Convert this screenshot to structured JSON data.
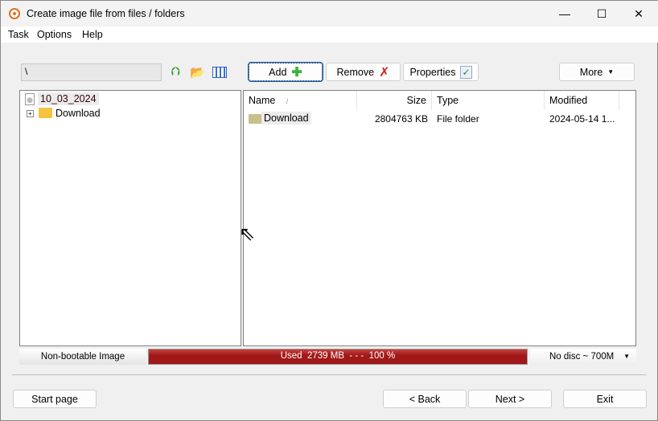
{
  "window": {
    "title": "Create image file from files / folders",
    "minimize": "—",
    "maximize": "☐",
    "close": "✕"
  },
  "menu": [
    "Task",
    "Options",
    "Help"
  ],
  "toolbar": {
    "path": "\\",
    "add": "Add",
    "remove": "Remove",
    "properties": "Properties",
    "more": "More"
  },
  "tree": {
    "root": "10_03_2024",
    "child": "Download",
    "expander": "+"
  },
  "list": {
    "columns": [
      "Name",
      "Size",
      "Type",
      "Modified"
    ],
    "rows": [
      {
        "name": "Download",
        "size": "2804763 KB",
        "type": "File folder",
        "modified": "2024-05-14 1..."
      }
    ]
  },
  "status": {
    "boot": "Non-bootable Image",
    "usage": "Used  2739 MB  - - -  100 %",
    "usage_percent": 100,
    "disc": "No disc ~ 700M"
  },
  "footer": {
    "start": "Start page",
    "back": "< Back",
    "next": "Next >",
    "exit": "Exit"
  }
}
